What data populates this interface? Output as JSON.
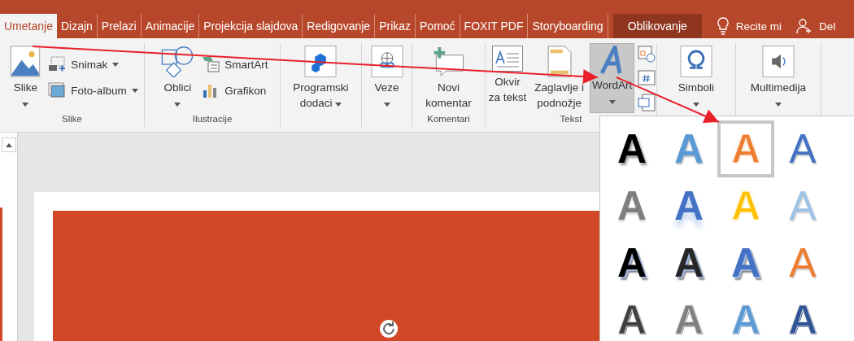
{
  "tabs": [
    {
      "label": "Umetanje",
      "selected": true,
      "contextual": false
    },
    {
      "label": "Dizajn",
      "selected": false,
      "contextual": false
    },
    {
      "label": "Prelazi",
      "selected": false,
      "contextual": false
    },
    {
      "label": "Animacije",
      "selected": false,
      "contextual": false
    },
    {
      "label": "Projekcija slajdova",
      "selected": false,
      "contextual": false
    },
    {
      "label": "Redigovanje",
      "selected": false,
      "contextual": false
    },
    {
      "label": "Prikaz",
      "selected": false,
      "contextual": false
    },
    {
      "label": "Pomoć",
      "selected": false,
      "contextual": false
    },
    {
      "label": "FOXIT PDF",
      "selected": false,
      "contextual": false
    },
    {
      "label": "Storyboarding",
      "selected": false,
      "contextual": false
    },
    {
      "label": "Oblikovanje",
      "selected": false,
      "contextual": true
    }
  ],
  "tell_me": {
    "label": "Recite mi"
  },
  "share": {
    "label": "Del"
  },
  "ribbon": {
    "groups": [
      {
        "label": "Slike",
        "buttons": [
          {
            "kind": "large",
            "label": "Slike",
            "dropdown": true,
            "pressed": false
          },
          {
            "kind": "small",
            "label": "Snimak",
            "dropdown": true,
            "pressed": false
          },
          {
            "kind": "small",
            "label": "Foto-album",
            "dropdown": true,
            "pressed": false
          }
        ]
      },
      {
        "label": "Ilustracije",
        "buttons": [
          {
            "kind": "large",
            "label": "Oblici",
            "dropdown": true,
            "pressed": false
          },
          {
            "kind": "small",
            "label": "SmartArt",
            "dropdown": false,
            "pressed": false
          },
          {
            "kind": "small",
            "label": "Grafikon",
            "dropdown": false,
            "pressed": false
          }
        ]
      },
      {
        "buttons": [
          {
            "kind": "large",
            "label": "Programski\ndodaci",
            "dropdown": true,
            "pressed": false
          }
        ]
      },
      {
        "buttons": [
          {
            "kind": "large",
            "label": "Veze",
            "dropdown": true,
            "pressed": false
          }
        ]
      },
      {
        "label": "Komentari",
        "buttons": [
          {
            "kind": "large",
            "label": "Novi\nkomentar",
            "dropdown": false,
            "pressed": false
          }
        ]
      },
      {
        "label": "Tekst",
        "buttons": [
          {
            "kind": "large",
            "label": "Okvir\nza tekst",
            "dropdown": false,
            "pressed": false
          },
          {
            "kind": "large",
            "label": "Zaglavlje i\npodnožje",
            "dropdown": false,
            "pressed": false
          },
          {
            "kind": "large",
            "label": "WordArt",
            "dropdown": true,
            "pressed": true
          },
          {
            "kind": "icon",
            "dropdown": false,
            "pressed": false
          },
          {
            "kind": "icon",
            "dropdown": false,
            "pressed": false
          },
          {
            "kind": "icon",
            "dropdown": false,
            "pressed": false
          }
        ]
      },
      {
        "buttons": [
          {
            "kind": "large",
            "label": "Simboli",
            "dropdown": true,
            "pressed": false
          }
        ]
      },
      {
        "buttons": [
          {
            "kind": "large",
            "label": "Multimedija",
            "dropdown": true,
            "pressed": false
          }
        ]
      }
    ]
  },
  "wordart_gallery": {
    "items": [
      {
        "letter": "A",
        "kind": "shadow",
        "color": "#000000",
        "selected": false
      },
      {
        "letter": "A",
        "kind": "solid",
        "color": "#5b9bd5",
        "selected": false
      },
      {
        "letter": "A",
        "kind": "outline-fill",
        "color": "#ed7d31",
        "selected": true
      },
      {
        "letter": "A",
        "kind": "outline",
        "color": "#4472c4",
        "selected": false
      },
      {
        "letter": "A",
        "kind": "gradient",
        "color": "#7f7f7f",
        "selected": false
      },
      {
        "letter": "A",
        "kind": "reflection",
        "color": "#4472c4",
        "selected": false
      },
      {
        "letter": "A",
        "kind": "outline-fill",
        "color": "#ffc000",
        "selected": false
      },
      {
        "letter": "A",
        "kind": "outline",
        "color": "#9dc3e6",
        "selected": false
      },
      {
        "letter": "A",
        "kind": "shadow3d",
        "color": "#000000",
        "selected": false
      },
      {
        "letter": "A",
        "kind": "shadow3d",
        "color": "#262626",
        "selected": false
      },
      {
        "letter": "A",
        "kind": "shadow3d",
        "color": "#4472c4",
        "selected": false
      },
      {
        "letter": "A",
        "kind": "outline",
        "color": "#ed7d31",
        "selected": false
      },
      {
        "letter": "A",
        "kind": "pattern",
        "color": "#404040",
        "selected": false
      },
      {
        "letter": "A",
        "kind": "pattern",
        "color": "#7f7f7f",
        "selected": false
      },
      {
        "letter": "A",
        "kind": "pattern",
        "color": "#5b9bd5",
        "selected": false
      },
      {
        "letter": "A",
        "kind": "pattern",
        "color": "#2f5597",
        "selected": false
      }
    ]
  }
}
